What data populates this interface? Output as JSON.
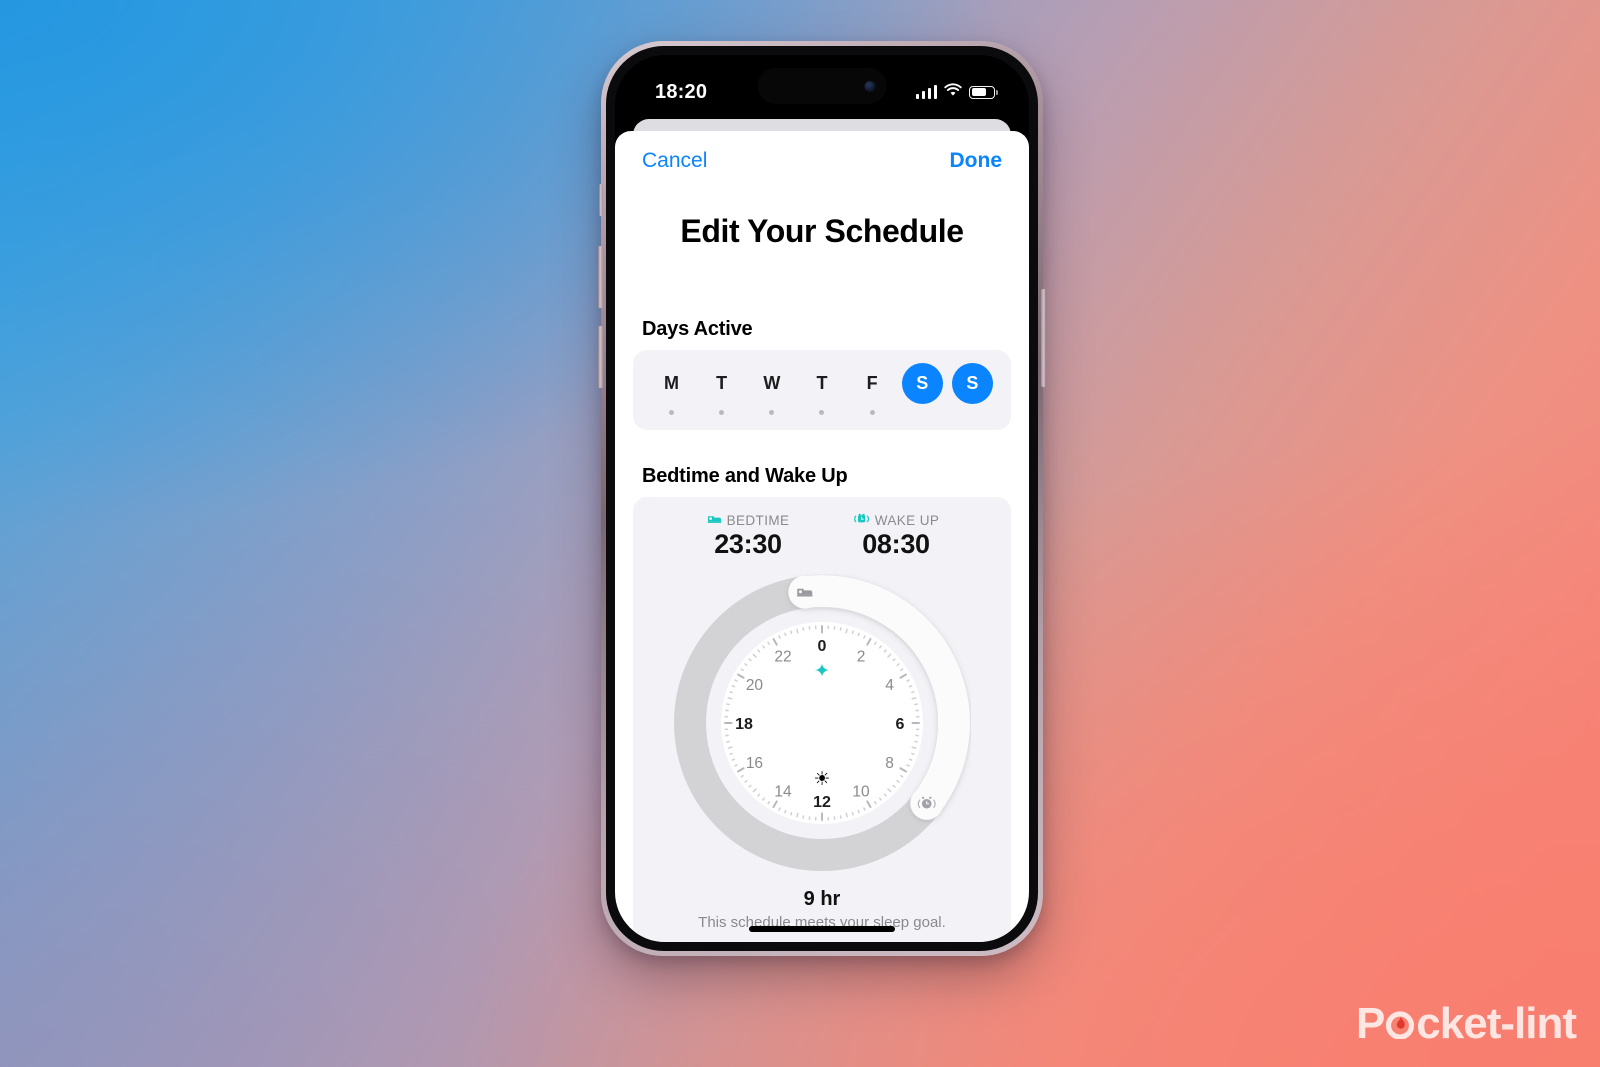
{
  "statusbar": {
    "time": "18:20",
    "signal_icon": "cellular-signal-icon",
    "wifi_icon": "wifi-icon",
    "battery_icon": "battery-icon"
  },
  "sheet": {
    "cancel_label": "Cancel",
    "done_label": "Done",
    "title": "Edit Your Schedule"
  },
  "days_active": {
    "section_label": "Days Active",
    "days": [
      {
        "letter": "M",
        "selected": false
      },
      {
        "letter": "T",
        "selected": false
      },
      {
        "letter": "W",
        "selected": false
      },
      {
        "letter": "T",
        "selected": false
      },
      {
        "letter": "F",
        "selected": false
      },
      {
        "letter": "S",
        "selected": true
      },
      {
        "letter": "S",
        "selected": true
      }
    ]
  },
  "bedtime": {
    "section_label": "Bedtime and Wake Up",
    "bedtime_label": "BEDTIME",
    "bedtime_value": "23:30",
    "bedtime_icon": "bed-icon",
    "wakeup_label": "WAKE UP",
    "wakeup_value": "08:30",
    "wakeup_icon": "alarm-clock-icon",
    "moon_icon": "sparkle-night-icon",
    "sun_icon": "sun-icon",
    "total_sleep": "9 hr",
    "note": "This schedule meets your sleep goal.",
    "dial": {
      "hour_labels": [
        "0",
        "2",
        "4",
        "6",
        "8",
        "10",
        "12",
        "14",
        "16",
        "18",
        "20",
        "22"
      ],
      "bold_hour_labels": [
        "0",
        "6",
        "12",
        "18"
      ],
      "bedtime_hour": 23.5,
      "wakeup_hour": 8.5,
      "track_color": "#d3d3d6",
      "arc_color": "#fbfbfc",
      "face_color": "#ffffff",
      "label_color": "#8a8a8e",
      "bold_label_color": "#1d1d1f"
    }
  },
  "colors": {
    "accent_blue": "#0a84ff",
    "teal": "#17c8c0",
    "card_gray": "#f2f2f7"
  },
  "watermark": {
    "text_before": "P",
    "text_after": "cket-lint",
    "flame_icon": "flame-icon"
  }
}
